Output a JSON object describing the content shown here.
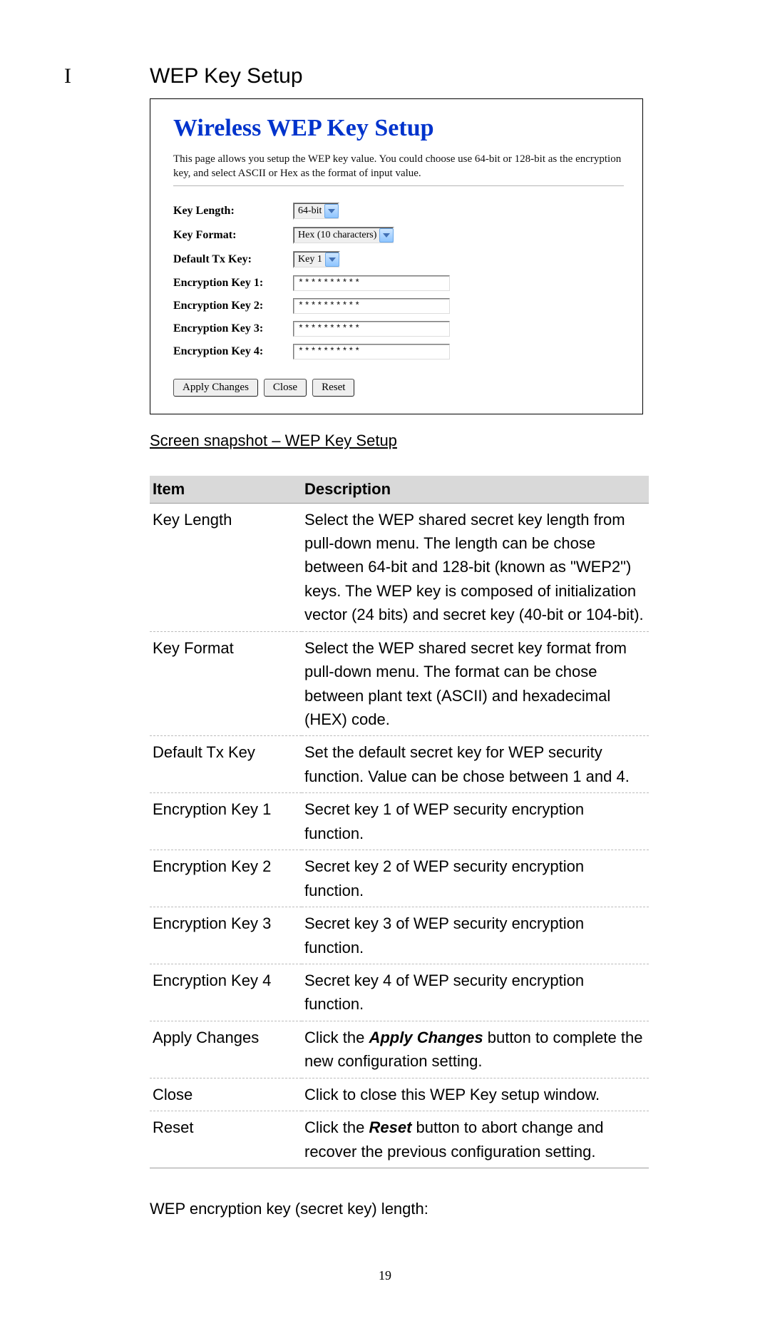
{
  "section": {
    "marker": "I",
    "title": "WEP Key Setup"
  },
  "panel": {
    "heading": "Wireless WEP Key Setup",
    "description": "This page allows you setup the WEP key value. You could choose use 64-bit or 128-bit as the encryption key, and select ASCII or Hex as the format of input value.",
    "rows": {
      "key_length_label": "Key Length:",
      "key_length_value": "64-bit",
      "key_format_label": "Key Format:",
      "key_format_value": "Hex (10 characters)",
      "default_tx_label": "Default Tx Key:",
      "default_tx_value": "Key 1",
      "enc1_label": "Encryption Key 1:",
      "enc1_value": "**********",
      "enc2_label": "Encryption Key 2:",
      "enc2_value": "**********",
      "enc3_label": "Encryption Key 3:",
      "enc3_value": "**********",
      "enc4_label": "Encryption Key 4:",
      "enc4_value": "**********"
    },
    "buttons": {
      "apply": "Apply Changes",
      "close": "Close",
      "reset": "Reset"
    }
  },
  "caption": "Screen snapshot – WEP Key Setup",
  "table": {
    "headers": {
      "item": "Item",
      "desc": "Description"
    },
    "rows": [
      {
        "item": "Key Length",
        "desc": "Select the WEP shared secret key length from pull-down menu. The length can be chose between 64-bit and 128-bit (known as \"WEP2\") keys. The WEP key is composed of initialization vector (24 bits) and secret key (40-bit or 104-bit)."
      },
      {
        "item": "Key Format",
        "desc": "Select the WEP shared secret key format from pull-down menu. The format can be chose between plant text (ASCII) and hexadecimal (HEX) code."
      },
      {
        "item": "Default Tx Key",
        "desc": "Set the default secret key for WEP security function. Value can be chose between 1 and 4."
      },
      {
        "item": "Encryption Key 1",
        "desc": "Secret key 1 of WEP security encryption function."
      },
      {
        "item": "Encryption Key 2",
        "desc": "Secret key 2 of WEP security encryption function."
      },
      {
        "item": "Encryption Key 3",
        "desc": "Secret key 3 of WEP security encryption function."
      },
      {
        "item": "Encryption Key 4",
        "desc": "Secret key 4 of WEP security encryption function."
      },
      {
        "item": "Apply Changes",
        "desc_prefix": "Click the ",
        "desc_bold": "Apply Changes",
        "desc_suffix": " button to complete the new configuration setting."
      },
      {
        "item": "Close",
        "desc": "Click to close this WEP Key setup window."
      },
      {
        "item": "Reset",
        "desc_prefix": "Click the ",
        "desc_bold": "Reset",
        "desc_suffix": " button to abort change and recover the previous configuration setting."
      }
    ]
  },
  "footer": "WEP encryption key (secret key) length:",
  "page_number": "19"
}
